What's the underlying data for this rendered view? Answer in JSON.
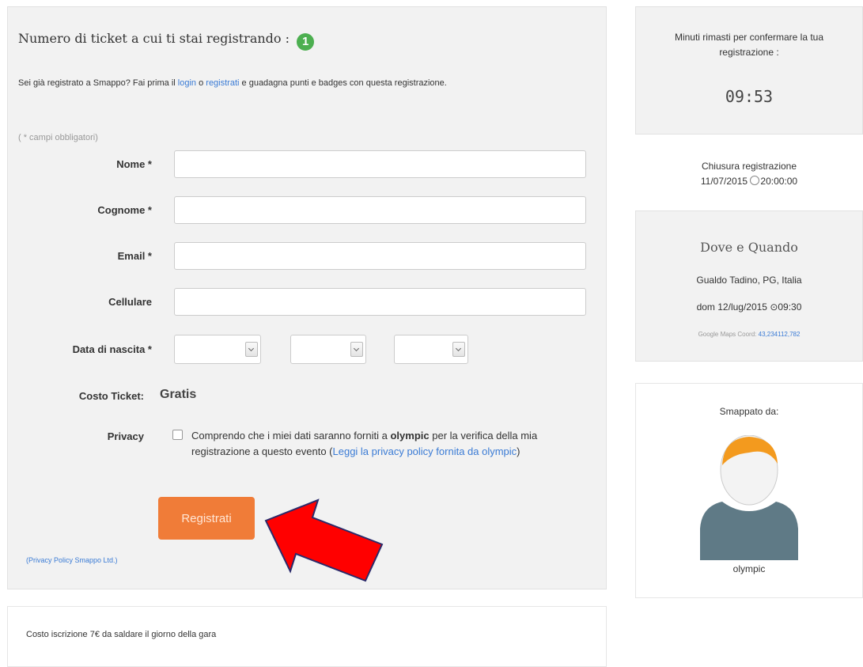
{
  "form": {
    "title": "Numero di ticket a cui ti stai registrando :",
    "ticket_count": "1",
    "intro_prefix": "Sei già registrato a Smappo? Fai prima il",
    "login_link": "login",
    "intro_or": "o",
    "register_link": "registrati",
    "intro_suffix": "e guadagna punti e badges con questa registrazione.",
    "required_note": "( * campi obbligatori)",
    "fields": {
      "nome": {
        "label": "Nome *",
        "value": ""
      },
      "cognome": {
        "label": "Cognome *",
        "value": ""
      },
      "email": {
        "label": "Email *",
        "value": ""
      },
      "cellulare": {
        "label": "Cellulare",
        "value": ""
      }
    },
    "birthdate": {
      "label": "Data di nascita *",
      "day": "",
      "month": "",
      "year": ""
    },
    "cost": {
      "label": "Costo Ticket:",
      "value": "Gratis"
    },
    "privacy": {
      "label": "Privacy",
      "checked": false,
      "text_prefix": "Comprendo che i miei dati saranno forniti a",
      "org": "olympic",
      "text_middle": "per la verifica della mia registrazione a questo evento (",
      "policy_link": "Leggi la privacy policy fornita da olympic",
      "text_suffix": ")"
    },
    "submit_label": "Registrati",
    "privacy_policy_link": "(Privacy Policy Smappo Ltd.)"
  },
  "note": {
    "text": "Costo iscrizione 7€ da saldare il giorno della gara"
  },
  "timer": {
    "label": "Minuti rimasti per confermare la tua registrazione :",
    "value": "09:53"
  },
  "closing": {
    "label": "Chiusura registrazione",
    "date": "11/07/2015",
    "time": "20:00:00"
  },
  "location": {
    "title": "Dove e Quando",
    "place": "Gualdo Tadino, PG, Italia",
    "datetime": "dom 12/lug/2015 ⊙09:30",
    "coords_label": "Google Maps Coord:",
    "coords_link": "43,234112,782"
  },
  "owner": {
    "label": "Smappato da:",
    "name": "olympic"
  },
  "colors": {
    "accent_orange": "#f07c38",
    "badge_green": "#4caf50",
    "link_blue": "#3a7bd5",
    "annotation_arrow": "#ff0000"
  }
}
